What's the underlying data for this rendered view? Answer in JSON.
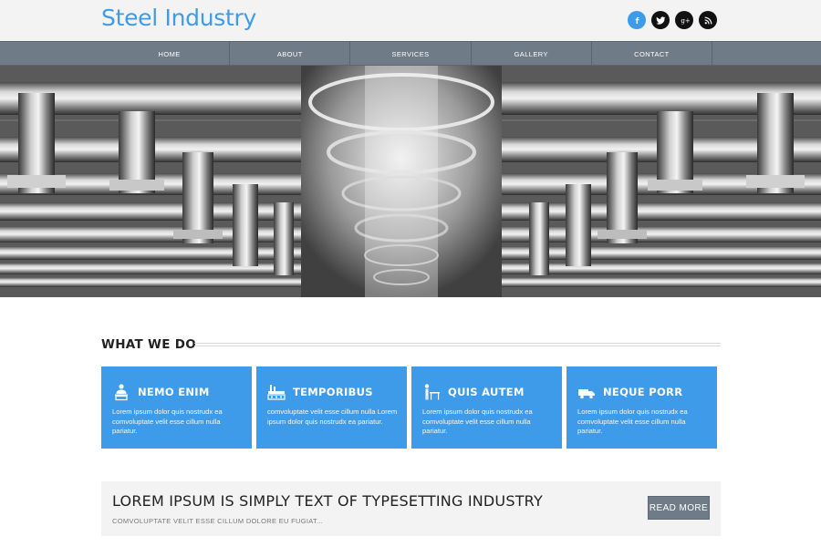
{
  "header": {
    "logo": "Steel Industry",
    "social": [
      {
        "icon": "facebook-icon",
        "glyph": "f"
      },
      {
        "icon": "twitter-icon",
        "glyph": "t"
      },
      {
        "icon": "google-plus-icon",
        "glyph": "g+"
      },
      {
        "icon": "rss-icon",
        "glyph": "rss"
      }
    ]
  },
  "nav": {
    "items": [
      "HOME",
      "ABOUT",
      "SERVICES",
      "GALLERY",
      "CONTACT"
    ]
  },
  "hero": {
    "image": "industrial-steel-ducts-photo"
  },
  "what_we_do": {
    "title": "WHAT WE DO",
    "cards": [
      {
        "title": "NEMO ENIM",
        "icon": "worker-icon",
        "text": "Lorem ipsum dolor quis nostrudx ea comvoluptate velit esse cillum nulla pariatur."
      },
      {
        "title": "TEMPORIBUS",
        "icon": "factory-icon",
        "text": "comvoluptate velit esse cillum nulla Lorem ipsum dolor quis nostrudx ea pariatur."
      },
      {
        "title": "QUIS AUTEM",
        "icon": "engineer-desk-icon",
        "text": "Lorem ipsum dolor quis nostrudx ea comvoluptate velit esse cillum nulla pariatur."
      },
      {
        "title": "NEQUE PORR",
        "icon": "truck-icon",
        "text": "Lorem ipsum dolor quis nostrudx ea comvoluptate velit esse cillum nulla pariatur."
      }
    ]
  },
  "banner": {
    "title": "LOREM IPSUM IS SIMPLY TEXT OF TYPESETTING INDUSTRY",
    "subtitle": "COMVOLUPTATE VELIT ESSE CILLUM DOLORE EU FUGIAT...",
    "button": "READ MORE"
  },
  "colors": {
    "accent": "#3d9be9",
    "nav": "#6f7b87",
    "header_bg": "#f3f3f3"
  }
}
